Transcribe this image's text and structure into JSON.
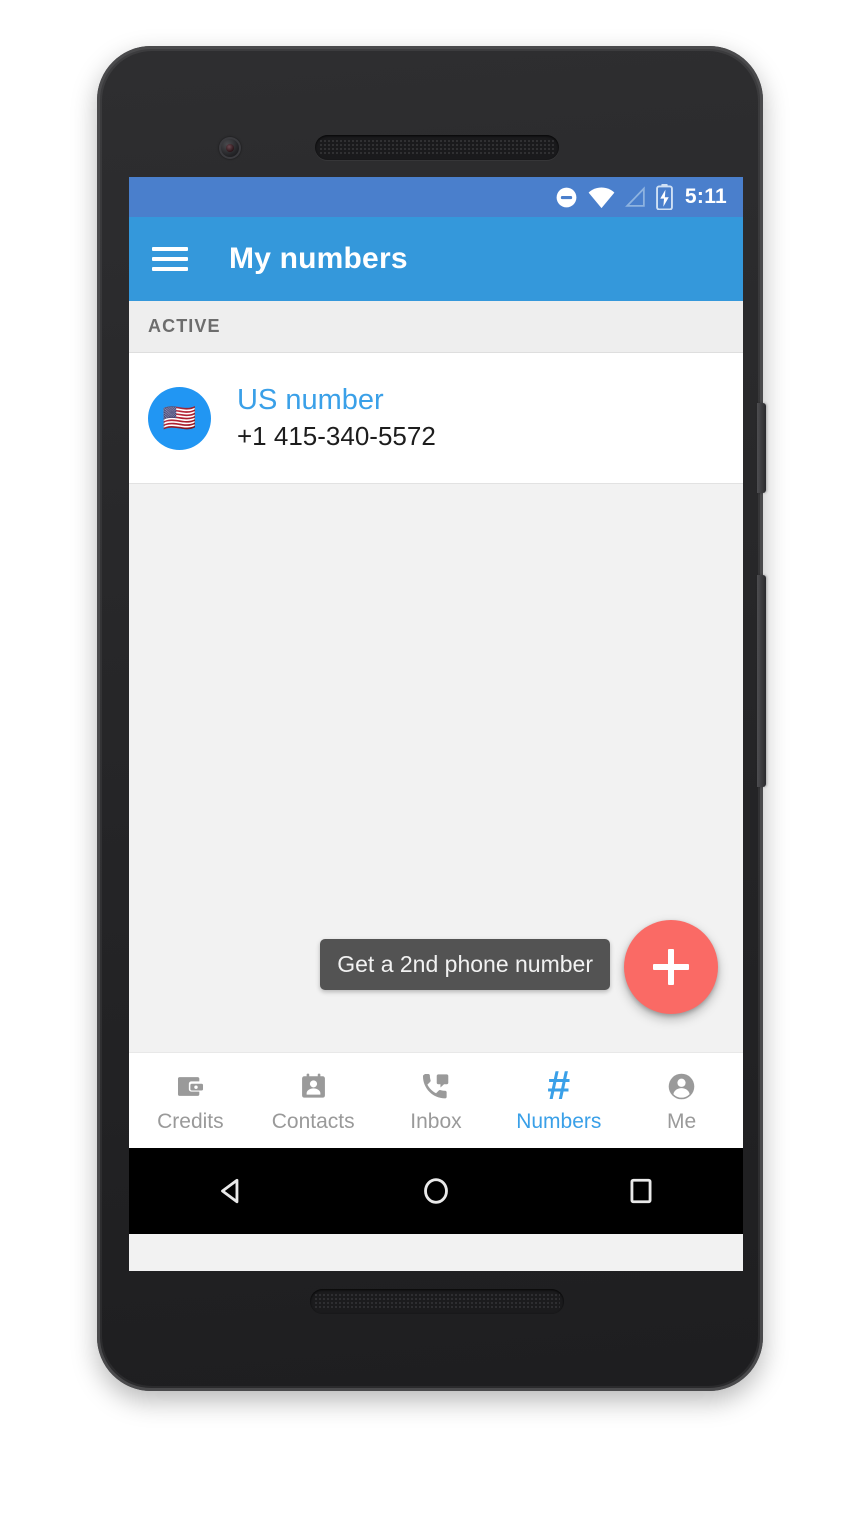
{
  "device": {
    "name": "android-phone-mockup",
    "camera": "front-camera",
    "earpiece": "earpiece-speaker",
    "bottom_speaker": "bottom-speaker-grille",
    "power_button": "power-button",
    "volume_button": "volume-rocker"
  },
  "status_bar": {
    "time": "5:11",
    "icons": [
      "do-not-disturb-icon",
      "wifi-icon",
      "cellular-signal-icon",
      "battery-charging-icon"
    ],
    "background": "#4a7fcc"
  },
  "app_bar": {
    "menu_icon": "hamburger-menu-icon",
    "title": "My numbers",
    "background": "#3498db"
  },
  "section": {
    "header": "ACTIVE"
  },
  "numbers": [
    {
      "avatar_icon": "us-flag-icon",
      "flag": "🇺🇸",
      "label": "US number",
      "value": "+1 415-340-5572",
      "label_color": "#3aa0e8"
    }
  ],
  "fab": {
    "icon": "plus-icon",
    "tooltip": "Get a 2nd phone number",
    "color": "#fa6a65"
  },
  "bottom_nav": {
    "active_index": 3,
    "active_color": "#3aa0e8",
    "inactive_color": "#9a9a9a",
    "items": [
      {
        "label": "Credits",
        "icon": "wallet-icon"
      },
      {
        "label": "Contacts",
        "icon": "contact-card-icon"
      },
      {
        "label": "Inbox",
        "icon": "phone-message-icon"
      },
      {
        "label": "Numbers",
        "icon": "hash-icon"
      },
      {
        "label": "Me",
        "icon": "person-icon"
      }
    ]
  },
  "android_nav": {
    "back": "back-triangle-icon",
    "home": "home-circle-icon",
    "recents": "recents-square-icon"
  }
}
